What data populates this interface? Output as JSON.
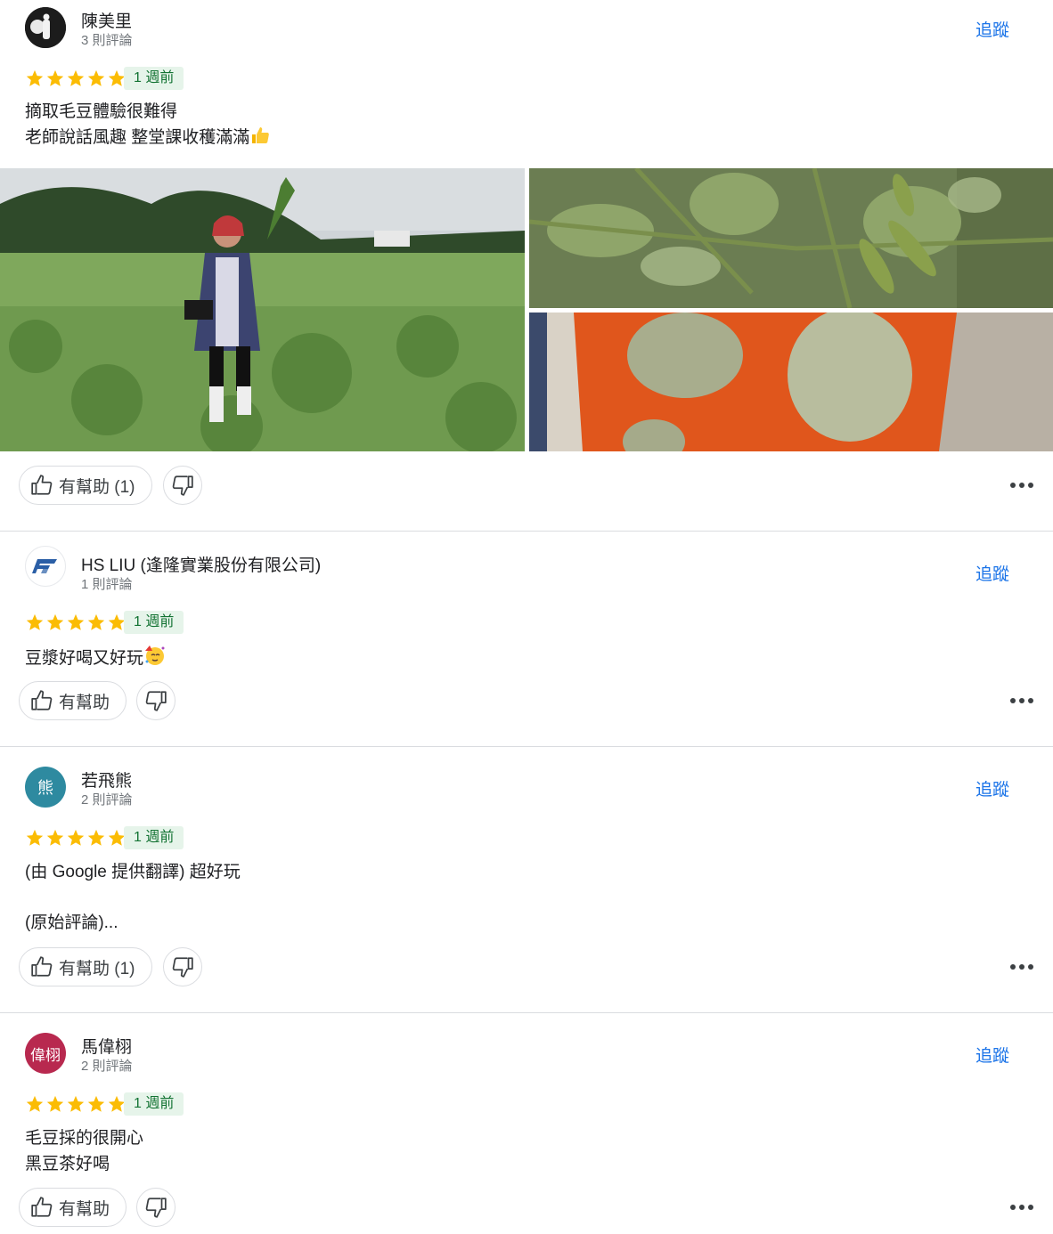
{
  "follow_label": "追蹤",
  "reviews": [
    {
      "name": "陳美里",
      "count": "3 則評論",
      "time": "1 週前",
      "lines": [
        "摘取毛豆體驗很難得",
        "老師說話風趣 整堂課收穫滿滿"
      ],
      "helpful": "有幫助 (1)",
      "avatar": "photo",
      "emoji": "thumbs-up-emoji"
    },
    {
      "name": "HS LIU (逢隆實業股份有限公司)",
      "count": "1 則評論",
      "time": "1 週前",
      "lines": [
        "豆漿好喝又好玩"
      ],
      "helpful": "有幫助",
      "avatar": "logo",
      "emoji": "party-face-emoji"
    },
    {
      "name": "若飛熊",
      "count": "2 則評論",
      "time": "1 週前",
      "lines": [
        "(由 Google 提供翻譯) 超好玩",
        "",
        "(原始評論)..."
      ],
      "helpful": "有幫助 (1)",
      "avatar_text": "熊",
      "avatar_color": "#2e8aa0"
    },
    {
      "name": "馬偉栩",
      "count": "2 則評論",
      "time": "1 週前",
      "lines": [
        "毛豆採的很開心",
        "黑豆茶好喝"
      ],
      "helpful": "有幫助",
      "avatar_text": "偉栩",
      "avatar_color": "#b8294f"
    }
  ],
  "colors": {
    "star": "#fbbc04",
    "follow": "#1a73e8",
    "badge_bg": "#e6f4ea",
    "badge_text": "#137333"
  }
}
